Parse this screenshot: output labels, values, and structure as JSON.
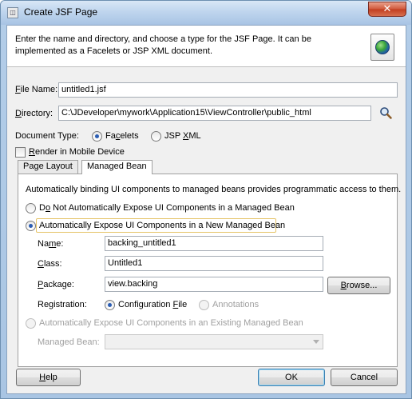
{
  "window": {
    "title": "Create JSF Page",
    "close_symbol": "✕"
  },
  "header": {
    "description": "Enter the name and directory, and choose a type for the JSF Page. It can be implemented as a Facelets or JSP XML document.",
    "icon": "globe-icon"
  },
  "form": {
    "file_name_label": "File Name:",
    "file_name_value": "untitled1.jsf",
    "directory_label": "Directory:",
    "directory_value": "C:\\JDeveloper\\mywork\\Application15\\ViewController\\public_html",
    "document_type_label": "Document Type:",
    "doc_types": [
      {
        "label": "Facelets",
        "selected": true
      },
      {
        "label": "JSP XML",
        "selected": false
      }
    ],
    "render_mobile_label": "Render in Mobile Device"
  },
  "tabs": [
    {
      "label": "Page Layout",
      "active": false
    },
    {
      "label": "Managed Bean",
      "active": true
    }
  ],
  "managed_bean": {
    "intro": "Automatically binding UI components to managed beans provides programmatic access to them.",
    "options": [
      "Do Not Automatically Expose UI Components in a Managed Bean",
      "Automatically Expose UI Components in a New Managed Bean",
      "Automatically Expose UI Components in an Existing Managed Bean"
    ],
    "name_label": "Name:",
    "name_value": "backing_untitled1",
    "class_label": "Class:",
    "class_value": "Untitled1",
    "package_label": "Package:",
    "package_value": "view.backing",
    "browse_label": "Browse...",
    "registration_label": "Registration:",
    "registration_options": [
      "Configuration File",
      "Annotations"
    ],
    "existing_bean_label": "Managed Bean:",
    "existing_bean_value": ""
  },
  "buttons": {
    "help": "Help",
    "ok": "OK",
    "cancel": "Cancel"
  },
  "colors": {
    "title_bar": "#bfd5ee",
    "close_button": "#c94a2c",
    "dialog_bg": "#f0f0f0",
    "radio_dot": "#2b5db3",
    "highlight": "#e5c365"
  }
}
